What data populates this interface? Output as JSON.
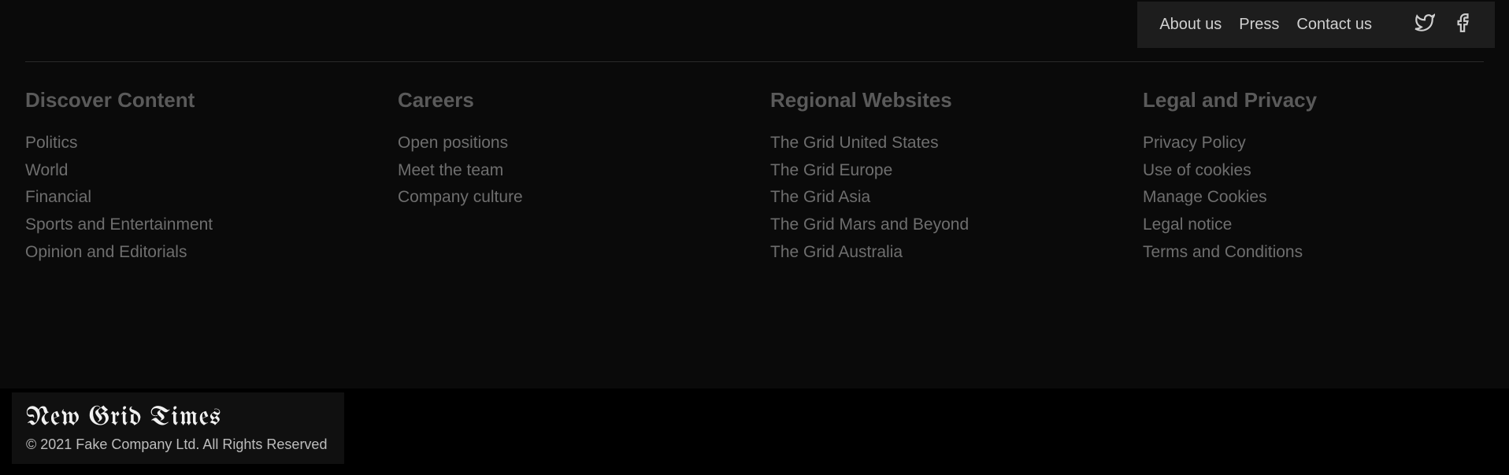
{
  "topNav": {
    "links": [
      "About us",
      "Press",
      "Contact us"
    ]
  },
  "columns": [
    {
      "title": "Discover Content",
      "items": [
        "Politics",
        "World",
        "Financial",
        "Sports and Entertainment",
        "Opinion and Editorials"
      ]
    },
    {
      "title": "Careers",
      "items": [
        "Open positions",
        "Meet the team",
        "Company culture"
      ]
    },
    {
      "title": "Regional Websites",
      "items": [
        "The Grid United States",
        "The Grid Europe",
        "The Grid Asia",
        "The Grid Mars and Beyond",
        "The Grid Australia"
      ]
    },
    {
      "title": "Legal and Privacy",
      "items": [
        "Privacy Policy",
        "Use of cookies",
        "Manage Cookies",
        "Legal notice",
        "Terms and Conditions"
      ]
    }
  ],
  "logo": "New Grid Times",
  "copyright": "© 2021 Fake Company Ltd. All Rights Reserved"
}
